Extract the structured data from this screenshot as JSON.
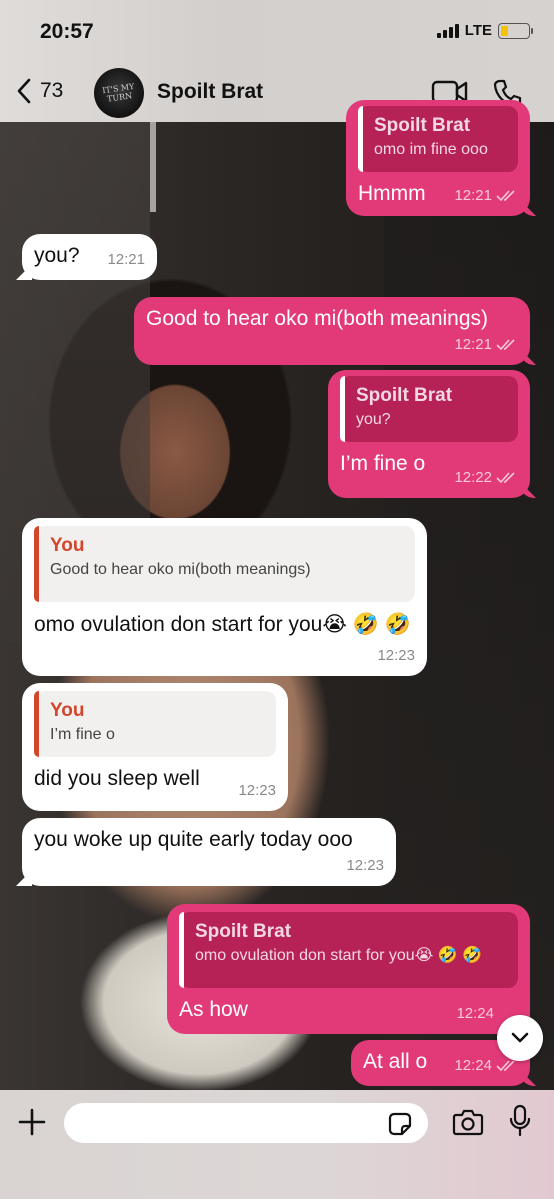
{
  "status_bar": {
    "time": "20:57",
    "network": "LTE",
    "battery_level": 0.28
  },
  "header": {
    "back_count": "73",
    "contact_name": "Spoilt Brat",
    "avatar_text": "IT'S MY TURN",
    "icons": [
      "back-chevron-icon",
      "video-call-icon",
      "phone-call-icon"
    ]
  },
  "messages": [
    {
      "dir": "out",
      "quote_author": "Spoilt Brat",
      "quote_text": "omo im fine ooo",
      "text": "Hmmm",
      "time": "12:21",
      "read": true
    },
    {
      "dir": "in",
      "text": "you?",
      "time": "12:21"
    },
    {
      "dir": "out",
      "text": "Good to hear oko mi(both meanings)",
      "time": "12:21",
      "read": true
    },
    {
      "dir": "out",
      "quote_author": "Spoilt Brat",
      "quote_text": "you?",
      "text": "I’m fine o",
      "time": "12:22",
      "read": true
    },
    {
      "dir": "in",
      "quote_author": "You",
      "quote_text": "Good to hear oko mi(both meanings)",
      "text": "omo ovulation don start for you😭 🤣 🤣",
      "time": "12:23"
    },
    {
      "dir": "in",
      "quote_author": "You",
      "quote_text": "I’m fine o",
      "text": "did you sleep well",
      "time": "12:23"
    },
    {
      "dir": "in",
      "text": "you woke up quite early today ooo",
      "time": "12:23"
    },
    {
      "dir": "out",
      "quote_author": "Spoilt Brat",
      "quote_text": "omo ovulation don start for you😭 🤣 🤣",
      "text": "As how",
      "time": "12:24",
      "read": true
    },
    {
      "dir": "out",
      "text": "At all o",
      "time": "12:24",
      "read": true
    }
  ],
  "composer": {
    "placeholder": "",
    "icons": [
      "plus-icon",
      "sticker-icon",
      "camera-icon",
      "microphone-icon"
    ]
  },
  "colors": {
    "outgoing_bubble": "#e23a78",
    "incoming_bubble": "#ffffff",
    "quote_accent_in": "#d2462b"
  }
}
